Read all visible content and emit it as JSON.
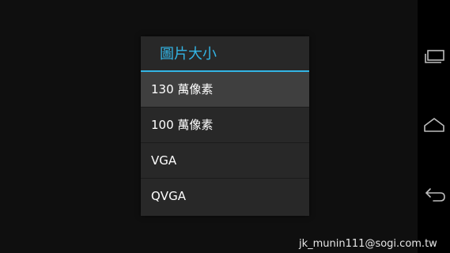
{
  "dialog": {
    "title": "圖片大小",
    "accent_color": "#33b5e5",
    "options": [
      {
        "label": "130 萬像素",
        "selected": true
      },
      {
        "label": "100 萬像素",
        "selected": false
      },
      {
        "label": "VGA",
        "selected": false
      },
      {
        "label": "QVGA",
        "selected": false
      }
    ]
  },
  "navbar": {
    "buttons": [
      "recent-apps-icon",
      "home-icon",
      "back-icon"
    ]
  },
  "watermark": "jk_munin111@sogi.com.tw"
}
